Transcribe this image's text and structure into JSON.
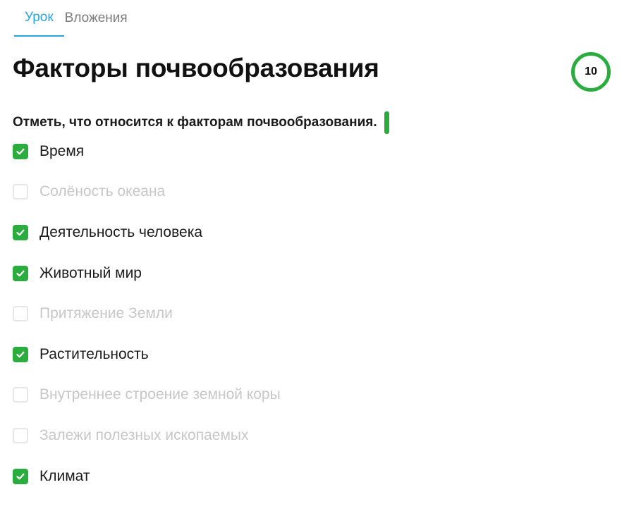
{
  "tabs": [
    {
      "label": "Урок",
      "active": true
    },
    {
      "label": "Вложения",
      "active": false
    }
  ],
  "title": "Факторы почвообразования",
  "score": "10",
  "question": "Отметь, что относится к факторам почвообразования.",
  "options": [
    {
      "label": "Время",
      "checked": true
    },
    {
      "label": "Солёность океана",
      "checked": false
    },
    {
      "label": "Деятельность человека",
      "checked": true
    },
    {
      "label": "Животный мир",
      "checked": true
    },
    {
      "label": "Притяжение Земли",
      "checked": false
    },
    {
      "label": "Растительность",
      "checked": true
    },
    {
      "label": "Внутреннее строение земной коры",
      "checked": false
    },
    {
      "label": "Залежи полезных ископаемых",
      "checked": false
    },
    {
      "label": "Климат",
      "checked": true
    }
  ],
  "colors": {
    "accent_blue": "#2aa4df",
    "correct_green": "#2bac3f",
    "muted_text": "#c7c7c7",
    "tab_inactive": "#7c7c7c"
  },
  "icons": {
    "checkmark": "check-icon"
  }
}
